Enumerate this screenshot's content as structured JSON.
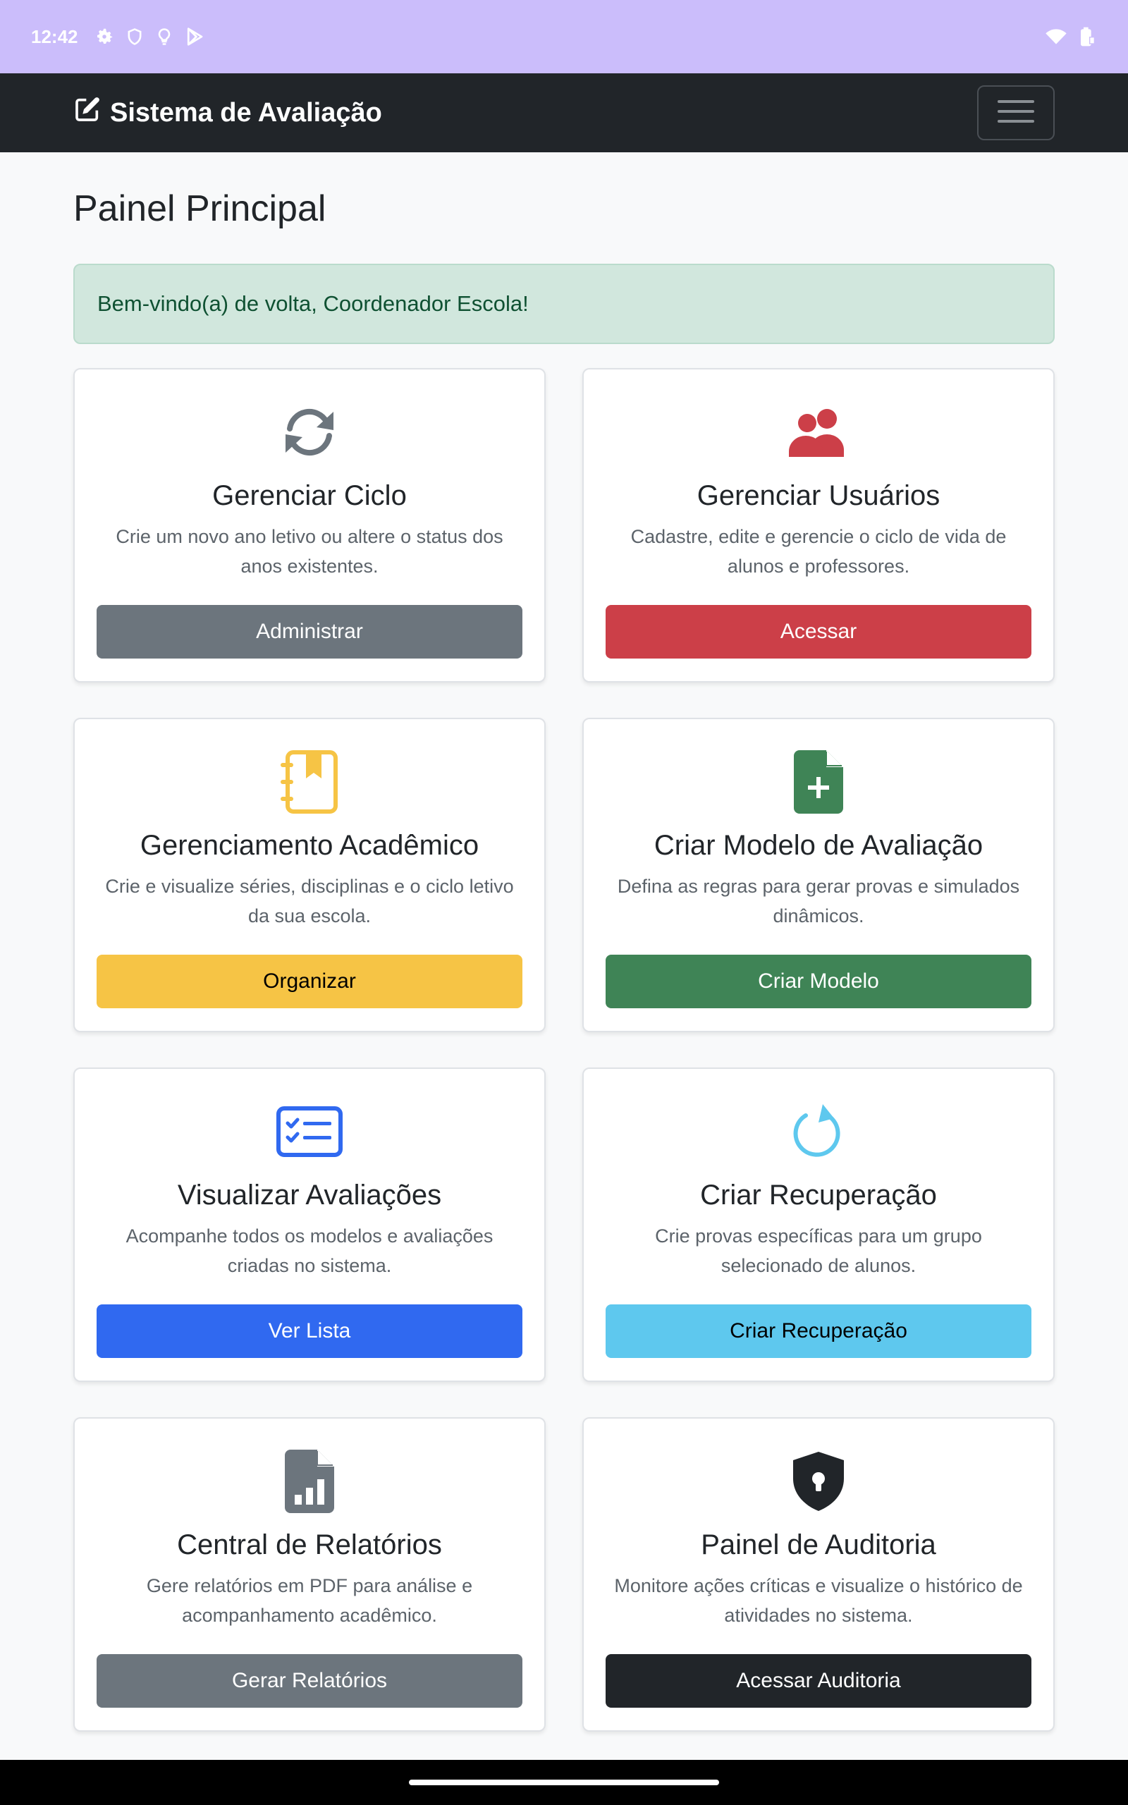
{
  "status_bar": {
    "time": "12:42",
    "left_icons": [
      "gear-icon",
      "shield-icon",
      "lightbulb-icon",
      "play-store-icon"
    ],
    "right_icons": [
      "wifi-icon",
      "battery-icon"
    ]
  },
  "navbar": {
    "brand": "Sistema de Avaliação",
    "brand_icon": "edit-square-icon",
    "toggler_icon": "hamburger-icon"
  },
  "page": {
    "title": "Painel Principal",
    "welcome": "Bem-vindo(a) de volta, Coordenador Escola!"
  },
  "cards": [
    {
      "title": "Gerenciar Ciclo",
      "description": "Crie um novo ano letivo ou altere o status dos anos existentes.",
      "button": "Administrar",
      "icon": "sync-icon",
      "color": "#6c757d"
    },
    {
      "title": "Gerenciar Usuários",
      "description": "Cadastre, edite e gerencie o ciclo de vida de alunos e professores.",
      "button": "Acessar",
      "icon": "users-icon",
      "color": "#cc3f48"
    },
    {
      "title": "Gerenciamento Acadêmico",
      "description": "Crie e visualize séries, disciplinas e o ciclo letivo da sua escola.",
      "button": "Organizar",
      "icon": "journal-bookmark-icon",
      "color": "#f6c445"
    },
    {
      "title": "Criar Modelo de Avaliação",
      "description": "Defina as regras para gerar provas e simulados dinâmicos.",
      "button": "Criar Modelo",
      "icon": "file-plus-icon",
      "color": "#3f8456"
    },
    {
      "title": "Visualizar Avaliações",
      "description": "Acompanhe todos os modelos e avaliações criadas no sistema.",
      "button": "Ver Lista",
      "icon": "checklist-icon",
      "color": "#3069f0"
    },
    {
      "title": "Criar Recuperação",
      "description": "Crie provas específicas para um grupo selecionado de alunos.",
      "button": "Criar Recuperação",
      "icon": "redo-icon",
      "color": "#5ec8ee"
    },
    {
      "title": "Central de Relatórios",
      "description": "Gere relatórios em PDF para análise e acompanhamento acadêmico.",
      "button": "Gerar Relatórios",
      "icon": "file-chart-icon",
      "color": "#6c757d"
    },
    {
      "title": "Painel de Auditoria",
      "description": "Monitore ações críticas e visualize o histórico de atividades no sistema.",
      "button": "Acessar Auditoria",
      "icon": "shield-lock-icon",
      "color": "#212529"
    }
  ]
}
